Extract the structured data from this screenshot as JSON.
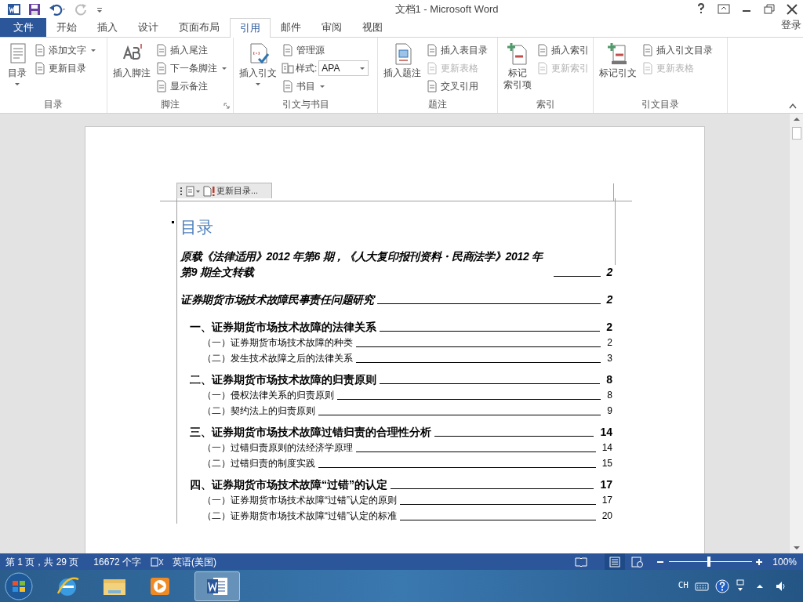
{
  "window": {
    "title": "文档1 - Microsoft Word"
  },
  "tabs": [
    {
      "label": "文件",
      "kind": "file",
      "selected": false
    },
    {
      "label": "开始",
      "kind": "tab",
      "selected": false
    },
    {
      "label": "插入",
      "kind": "tab",
      "selected": false
    },
    {
      "label": "设计",
      "kind": "tab",
      "selected": false
    },
    {
      "label": "页面布局",
      "kind": "tab",
      "selected": false
    },
    {
      "label": "引用",
      "kind": "tab",
      "selected": true
    },
    {
      "label": "邮件",
      "kind": "tab",
      "selected": false
    },
    {
      "label": "审阅",
      "kind": "tab",
      "selected": false
    },
    {
      "label": "视图",
      "kind": "tab",
      "selected": false
    }
  ],
  "account": "登录",
  "ribbon": [
    {
      "label": "目录",
      "launcher": false,
      "items": [
        {
          "kind": "large",
          "lines": [
            "目录"
          ],
          "dropdown": true,
          "disabled": false
        },
        {
          "kind": "small",
          "label": "添加文字",
          "dropdown": true,
          "disabled": false
        },
        {
          "kind": "small",
          "label": "更新目录",
          "dropdown": false,
          "disabled": false
        }
      ]
    },
    {
      "label": "脚注",
      "launcher": true,
      "items": [
        {
          "kind": "large",
          "lines": [
            "插入脚注"
          ],
          "dropdown": false,
          "disabled": false
        },
        {
          "kind": "small",
          "label": "插入尾注",
          "dropdown": false,
          "disabled": false
        },
        {
          "kind": "small",
          "label": "下一条脚注",
          "dropdown": true,
          "disabled": false
        },
        {
          "kind": "small",
          "label": "显示备注",
          "dropdown": false,
          "disabled": false
        }
      ]
    },
    {
      "label": "引文与书目",
      "launcher": false,
      "items": [
        {
          "kind": "large",
          "lines": [
            "插入引文"
          ],
          "dropdown": true,
          "disabled": false
        },
        {
          "kind": "small",
          "label": "管理源",
          "dropdown": false,
          "disabled": false
        },
        {
          "kind": "combo",
          "label": "样式:",
          "value": "APA"
        },
        {
          "kind": "small",
          "label": "书目",
          "dropdown": true,
          "disabled": false
        }
      ]
    },
    {
      "label": "题注",
      "launcher": false,
      "items": [
        {
          "kind": "large",
          "lines": [
            "插入题注"
          ],
          "dropdown": false,
          "disabled": false
        },
        {
          "kind": "small",
          "label": "插入表目录",
          "dropdown": false,
          "disabled": false
        },
        {
          "kind": "small",
          "label": "更新表格",
          "dropdown": false,
          "disabled": true
        },
        {
          "kind": "small",
          "label": "交叉引用",
          "dropdown": false,
          "disabled": false
        }
      ]
    },
    {
      "label": "索引",
      "launcher": false,
      "items": [
        {
          "kind": "large",
          "lines": [
            "标记",
            "索引项"
          ],
          "dropdown": false,
          "disabled": false
        },
        {
          "kind": "small",
          "label": "插入索引",
          "dropdown": false,
          "disabled": false
        },
        {
          "kind": "small",
          "label": "更新索引",
          "dropdown": false,
          "disabled": true
        }
      ]
    },
    {
      "label": "引文目录",
      "launcher": false,
      "items": [
        {
          "kind": "large",
          "lines": [
            "标记引文"
          ],
          "dropdown": false,
          "disabled": false
        },
        {
          "kind": "small",
          "label": "插入引文目录",
          "dropdown": false,
          "disabled": false
        },
        {
          "kind": "small",
          "label": "更新表格",
          "dropdown": false,
          "disabled": true
        }
      ]
    }
  ],
  "toc_toolbar": {
    "update_button": "更新目录..."
  },
  "document": {
    "heading": "目录",
    "entries": [
      {
        "kind": "title",
        "text": "原载《法律适用》2012 年第6 期，《人大复印报刊资料・民商法学》2012 年第9 期全文转载",
        "page": "2"
      },
      {
        "kind": "title",
        "text": "证券期货市场技术故障民事责任问题研究",
        "page": "2"
      },
      {
        "kind": "chapter",
        "text": "一、证券期货市场技术故障的法律关系",
        "page": "2"
      },
      {
        "kind": "section",
        "text": "（一）证券期货市场技术故障的种类",
        "page": "2"
      },
      {
        "kind": "section",
        "text": "（二）发生技术故障之后的法律关系",
        "page": "3"
      },
      {
        "kind": "chapter",
        "text": "二、证券期货市场技术故障的归责原则",
        "page": "8"
      },
      {
        "kind": "section",
        "text": "（一）侵权法律关系的归责原则",
        "page": "8"
      },
      {
        "kind": "section",
        "text": "（二）契约法上的归责原则",
        "page": "9"
      },
      {
        "kind": "chapter",
        "text": "三、证券期货市场技术故障过错归责的合理性分析",
        "page": "14"
      },
      {
        "kind": "section",
        "text": "（一）过错归责原则的法经济学原理",
        "page": "14"
      },
      {
        "kind": "section",
        "text": "（二）过错归责的制度实践",
        "page": "15"
      },
      {
        "kind": "chapter",
        "text": "四、证券期货市场技术故障“过错”的认定",
        "page": "17"
      },
      {
        "kind": "section",
        "text": "（一）证券期货市场技术故障“过错”认定的原则",
        "page": "17"
      },
      {
        "kind": "section",
        "text": "（二）证券期货市场技术故障“过错”认定的标准",
        "page": "20"
      }
    ]
  },
  "status_bar": {
    "page": "第 1 页，共 29 页",
    "words": "16672 个字",
    "language": "英语(美国)",
    "zoom": {
      "level": 0.48,
      "reading": "100%"
    }
  },
  "taskbar": {
    "input_language": "CH"
  }
}
